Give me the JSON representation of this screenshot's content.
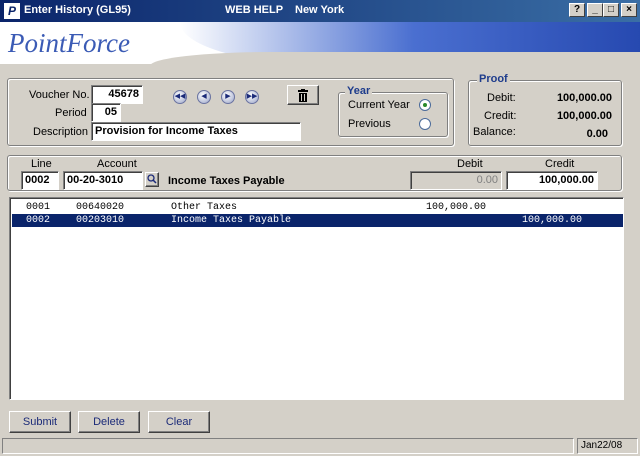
{
  "window": {
    "title": "Enter History (GL95)",
    "web_help": "WEB HELP",
    "location": "New York",
    "help_glyph": "?",
    "minimize_glyph": "_",
    "maximize_glyph": "□",
    "close_glyph": "×"
  },
  "banner": {
    "logo": "PointForce"
  },
  "voucher": {
    "voucher_label": "Voucher No.",
    "voucher_value": "45678",
    "period_label": "Period",
    "period_value": "05",
    "description_label": "Description",
    "description_value": "Provision for Income Taxes"
  },
  "year": {
    "legend": "Year",
    "current_label": "Current Year",
    "previous_label": "Previous",
    "selected": "current"
  },
  "proof": {
    "legend": "Proof",
    "debit_label": "Debit:",
    "debit_value": "100,000.00",
    "credit_label": "Credit:",
    "credit_value": "100,000.00",
    "balance_label": "Balance:",
    "balance_value": "0.00"
  },
  "entry": {
    "line_label": "Line",
    "line_value": "0002",
    "account_label": "Account",
    "account_value": "00-20-3010",
    "account_name": "Income Taxes Payable",
    "debit_label": "Debit",
    "debit_value": "0.00",
    "credit_label": "Credit",
    "credit_value": "100,000.00"
  },
  "lines": [
    {
      "line": "0001",
      "account": "00640020",
      "description": "Other Taxes",
      "debit": "100,000.00",
      "credit": "",
      "selected": false
    },
    {
      "line": "0002",
      "account": "00203010",
      "description": "Income Taxes Payable",
      "debit": "",
      "credit": "100,000.00",
      "selected": true
    }
  ],
  "buttons": {
    "submit": "Submit",
    "delete": "Delete",
    "clear": "Clear"
  },
  "status": {
    "date": "Jan22/08"
  },
  "colors": {
    "selection": "#0a246a",
    "brand": "#3b5bb5",
    "radio_on": "#2b8a2b"
  }
}
